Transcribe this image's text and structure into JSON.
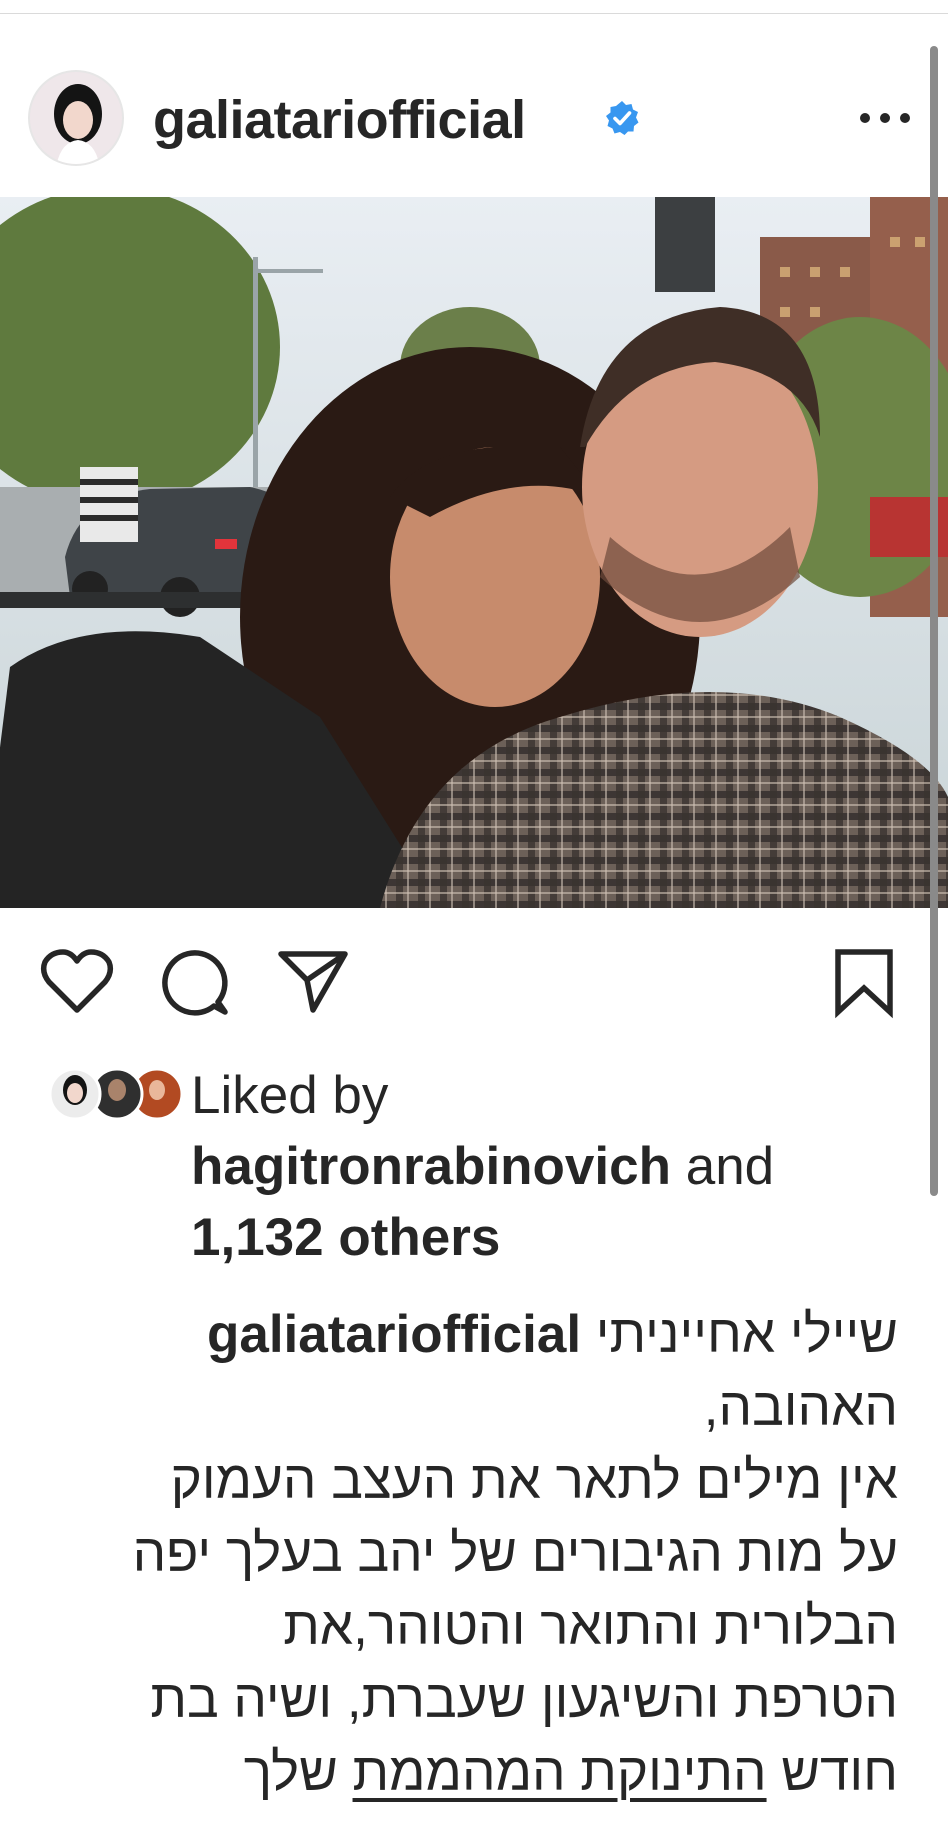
{
  "post": {
    "username": "galiatariofficial",
    "verified": true,
    "avatar_icon": "profile-photo",
    "more_icon": "more-horizontal-icon"
  },
  "photo": {
    "description_icon": "selfie-photo"
  },
  "actions": {
    "like_icon": "heart-icon",
    "comment_icon": "comment-icon",
    "share_icon": "send-icon",
    "save_icon": "bookmark-icon"
  },
  "likes": {
    "prefix": "Liked by",
    "user": "hagitronrabinovich",
    "and": "and",
    "others": "1,132 others"
  },
  "caption": {
    "user": "galiatariofficial",
    "lines": [
      "שיילי אחייניתי",
      "האהובה,",
      "אין מילים לתאר את העצב העמוק",
      "על מות הגיבורים של יהב בעלך יפה",
      "הבלורית והתואר והטוהר,את",
      "הטרפת והשיגעון שעברת, ושיה בת",
      "חודש"
    ],
    "tag_text": "התינוקת המהממת",
    "tag_suffix": "שלך"
  },
  "colors": {
    "verified_blue": "#3897f0",
    "text": "#262626",
    "icon": "#262626"
  }
}
